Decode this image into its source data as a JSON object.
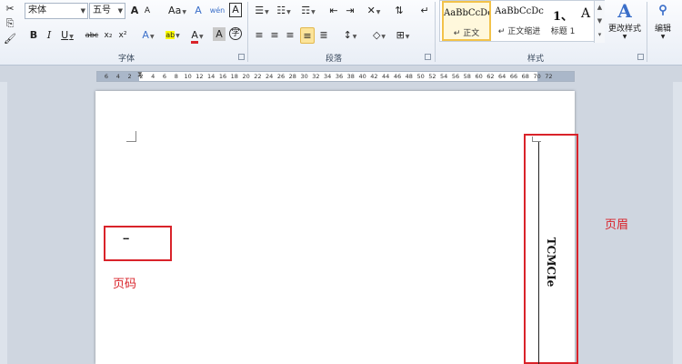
{
  "ribbon": {
    "font": {
      "name_value": "宋体",
      "size_value": "五号",
      "grow_label": "A",
      "shrink_label": "A",
      "case_label": "Aa",
      "clear_label": "A",
      "pinyin_label": "wén",
      "charborder_label": "A",
      "bold_label": "B",
      "italic_label": "I",
      "underline_label": "U",
      "strike_label": "abc",
      "sub_label": "x₂",
      "super_label": "x²",
      "effects_label": "A",
      "highlight_label": "ab",
      "color_label": "A",
      "shade_label": "A",
      "circle_label": "字",
      "group_label": "字体"
    },
    "paragraph": {
      "group_label": "段落"
    },
    "styles": {
      "items": [
        {
          "sample": "AaBbCcDc",
          "caption": "↵ 正文"
        },
        {
          "sample": "AaBbCcDc",
          "caption": "↵ 正文缩进"
        },
        {
          "sample": "1、",
          "caption": "标题 1"
        }
      ],
      "extra_sample": "A",
      "change_label": "更改样式",
      "group_label": "样式"
    },
    "editing": {
      "label": "编辑"
    }
  },
  "ruler": {
    "ticks": [
      "6",
      "4",
      "2",
      "2",
      "4",
      "6",
      "8",
      "10",
      "12",
      "14",
      "16",
      "18",
      "20",
      "22",
      "24",
      "26",
      "28",
      "30",
      "32",
      "34",
      "36",
      "38",
      "40",
      "42",
      "44",
      "46",
      "48",
      "50",
      "52",
      "54",
      "56",
      "58",
      "60",
      "62",
      "64",
      "66",
      "68",
      "70",
      "72"
    ]
  },
  "document": {
    "page_number_text": "--",
    "header_text": "TCMCIe"
  },
  "annotations": {
    "page_number_label": "页码",
    "header_label": "页眉"
  },
  "colors": {
    "annotation_red": "#d9232a",
    "selected_style": "#f2c24a"
  }
}
